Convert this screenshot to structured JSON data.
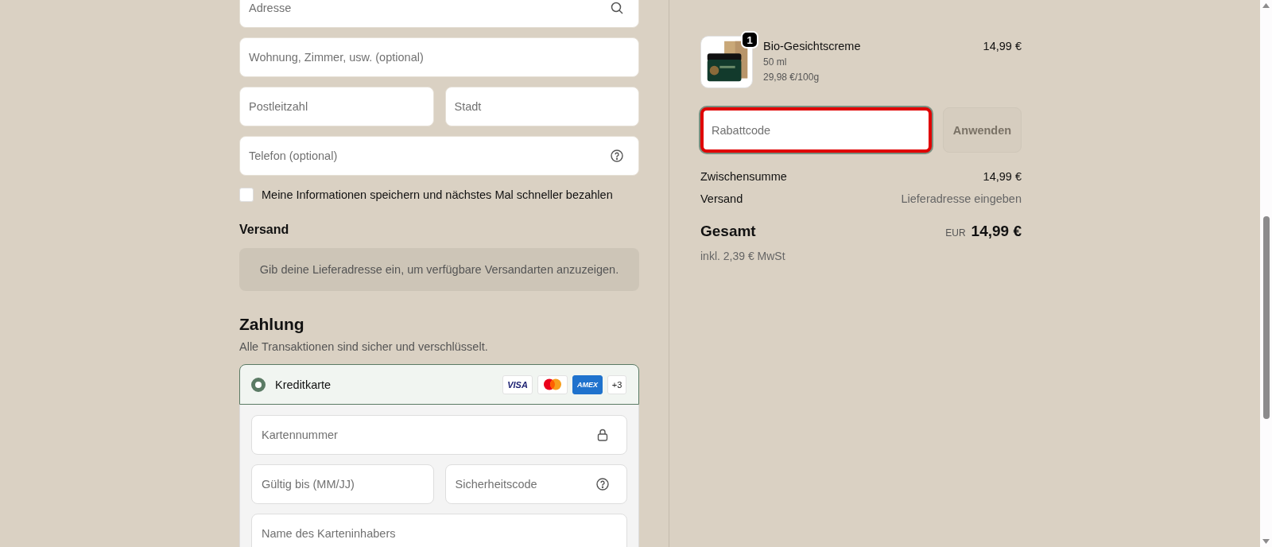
{
  "address_form": {
    "rows": [
      [
        {
          "placeholder": "Adresse",
          "kind": "search"
        }
      ],
      [
        {
          "placeholder": "Wohnung, Zimmer, usw. (optional)",
          "kind": "plain"
        }
      ],
      [
        {
          "placeholder": "Postleitzahl",
          "kind": "plain"
        },
        {
          "placeholder": "Stadt",
          "kind": "plain"
        }
      ],
      [
        {
          "placeholder": "Telefon (optional)",
          "kind": "help"
        }
      ]
    ],
    "save_info": {
      "label": "Meine Informationen speichern und nächstes Mal schneller bezahlen",
      "checked": false
    }
  },
  "shipping": {
    "heading": "Versand",
    "notice": "Gib deine Lieferadresse ein, um verfügbare Versandarten anzuzeigen."
  },
  "payment": {
    "heading": "Zahlung",
    "subtitle": "Alle Transaktionen sind sicher und verschlüsselt.",
    "methods": [
      {
        "label": "Kreditkarte",
        "selected": true,
        "brands": [
          {
            "kind": "visa",
            "label": "VISA"
          },
          {
            "kind": "mastercard"
          },
          {
            "kind": "amex",
            "label": "AMEX"
          },
          {
            "kind": "more",
            "label": "+3"
          }
        ]
      }
    ],
    "card_fields": [
      [
        {
          "placeholder": "Kartennummer",
          "kind": "lock"
        }
      ],
      [
        {
          "placeholder": "Gültig bis (MM/JJ)",
          "kind": "plain"
        },
        {
          "placeholder": "Sicherheitscode",
          "kind": "help"
        }
      ],
      [
        {
          "placeholder": "Name des Karteninhabers",
          "kind": "plain"
        }
      ]
    ]
  },
  "order": {
    "items": [
      {
        "name": "Bio-Gesichtscreme",
        "variant": "50 ml",
        "unit_price": "29,98 €/100g",
        "price": "14,99 €",
        "quantity": "1"
      }
    ],
    "discount": {
      "placeholder": "Rabattcode",
      "focused": true
    },
    "apply_button": {
      "label": "Anwenden",
      "disabled": true
    },
    "summary": [
      {
        "label": "Zwischensumme",
        "value": "14,99 €",
        "kind": "amount"
      },
      {
        "label": "Versand",
        "value": "Lieferadresse eingeben",
        "kind": "note"
      }
    ],
    "total": {
      "label": "Gesamt",
      "currency": "EUR",
      "amount": "14,99 €",
      "tax_note": "inkl. 2,39 € MwSt"
    }
  }
}
